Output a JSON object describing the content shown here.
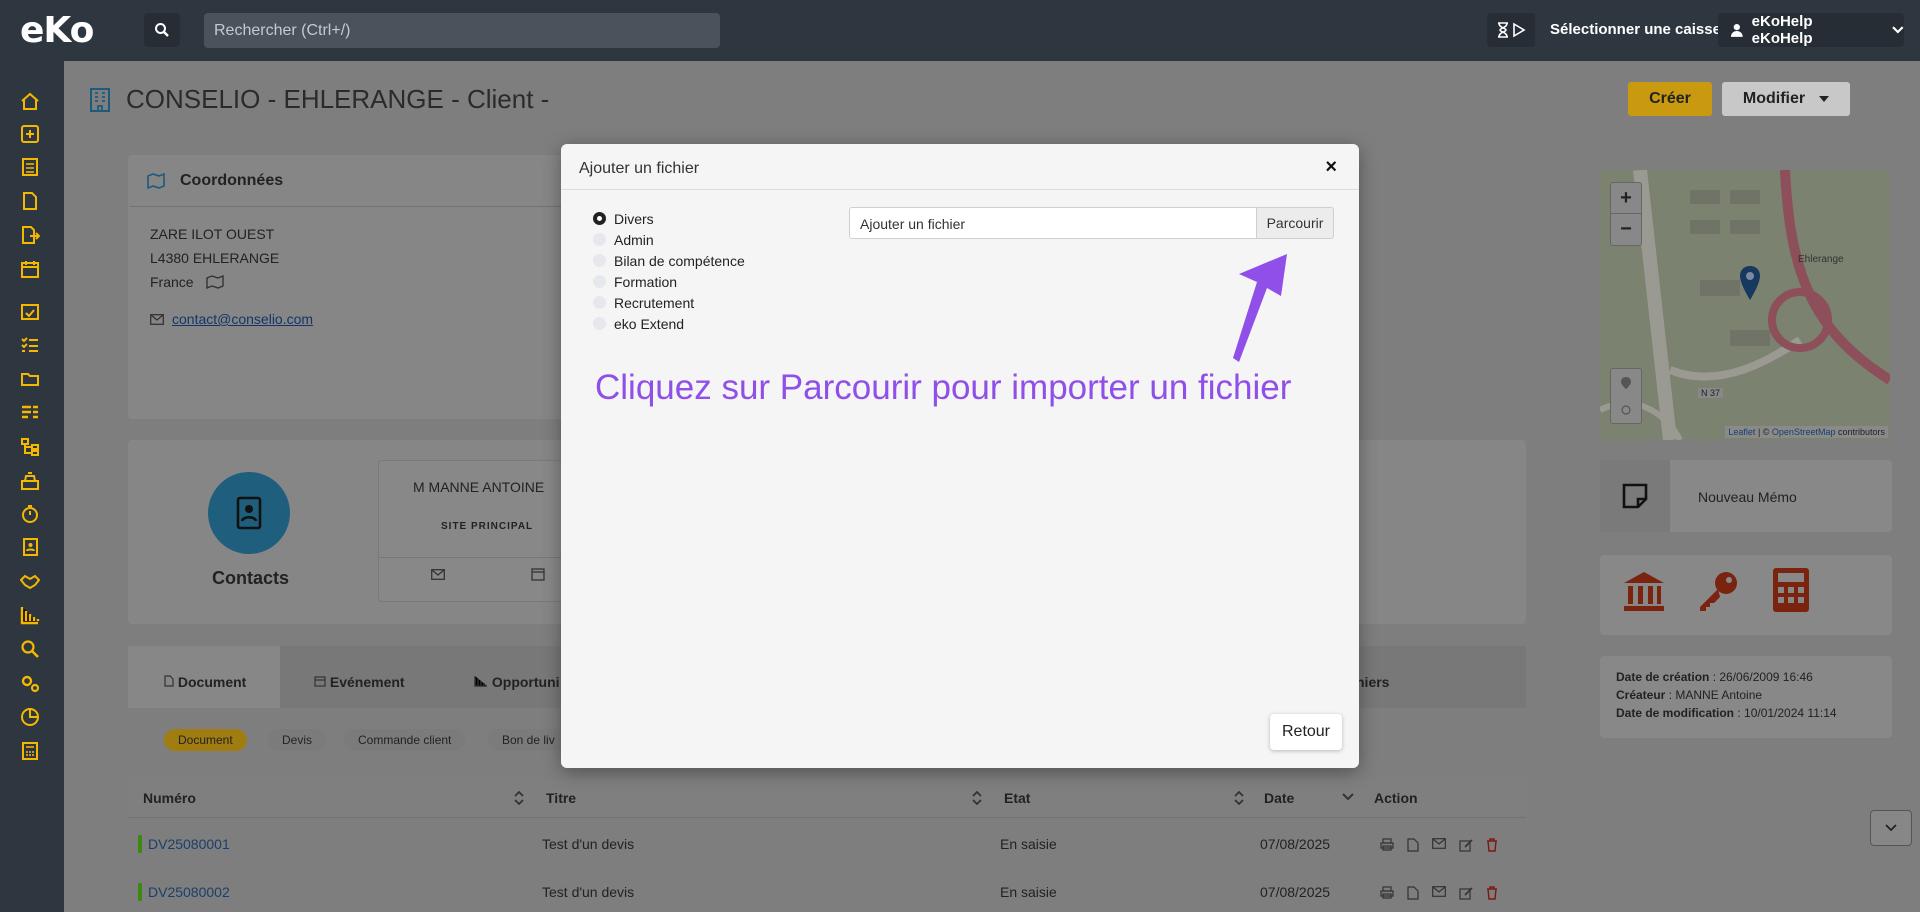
{
  "topbar": {
    "logo": "eKo",
    "search_placeholder": "Rechercher (Ctrl+/)",
    "caisse_label": "Sélectionner une caisse",
    "user_label": "eKoHelp eKoHelp"
  },
  "page": {
    "title": "CONSELIO - EHLERANGE - Client -",
    "create_label": "Créer",
    "modify_label": "Modifier"
  },
  "coordonnees": {
    "heading": "Coordonnées",
    "address_line1": "ZARE ILOT OUEST",
    "address_line2": "L4380 EHLERANGE",
    "country": "France",
    "email": "contact@conselio.com"
  },
  "contacts": {
    "label": "Contacts",
    "person_name": "M MANNE ANTOINE",
    "person_site": "SITE PRINCIPAL"
  },
  "tabs": [
    {
      "label": "Document"
    },
    {
      "label": "Evénement"
    },
    {
      "label": "Opportuni"
    },
    {
      "label": "hiers"
    }
  ],
  "pills": [
    {
      "label": "Document"
    },
    {
      "label": "Devis"
    },
    {
      "label": "Commande client"
    },
    {
      "label": "Bon de liv"
    }
  ],
  "table": {
    "columns": [
      "Numéro",
      "Titre",
      "Etat",
      "Date",
      "Action"
    ],
    "rows": [
      {
        "numero": "DV25080001",
        "titre": "Test d'un devis",
        "etat": "En saisie",
        "date": "07/08/2025"
      },
      {
        "numero": "DV25080002",
        "titre": "Test d'un devis",
        "etat": "En saisie",
        "date": "07/08/2025"
      }
    ]
  },
  "map": {
    "zoom_in": "+",
    "zoom_out": "−",
    "attribution_leaflet": "Leaflet",
    "attribution_sep": " | © ",
    "attribution_osm": "OpenStreetMap",
    "attribution_contrib": " contributors",
    "road_label": "N 37",
    "place_label": "Ehlerange"
  },
  "memo": {
    "label": "Nouveau Mémo"
  },
  "meta": {
    "creation_label": "Date de création",
    "creation_value": " : 26/06/2009 16:46",
    "creator_label": "Créateur",
    "creator_value": " : MANNE Antoine",
    "modif_label": "Date de modification",
    "modif_value": " : 10/01/2024 11:14"
  },
  "modal": {
    "title": "Ajouter un fichier",
    "close": "×",
    "categories": [
      {
        "label": "Divers",
        "checked": true
      },
      {
        "label": "Admin",
        "checked": false
      },
      {
        "label": "Bilan de compétence",
        "checked": false
      },
      {
        "label": "Formation",
        "checked": false
      },
      {
        "label": "Recrutement",
        "checked": false
      },
      {
        "label": "eko Extend",
        "checked": false
      }
    ],
    "file_placeholder": "Ajouter un fichier",
    "browse_label": "Parcourir",
    "hint": "Cliquez sur Parcourir pour importer un fichier",
    "back_label": "Retour"
  },
  "colors": {
    "accent": "#f5b800",
    "topbar": "#2e3640",
    "hint": "#8f4fe8"
  }
}
